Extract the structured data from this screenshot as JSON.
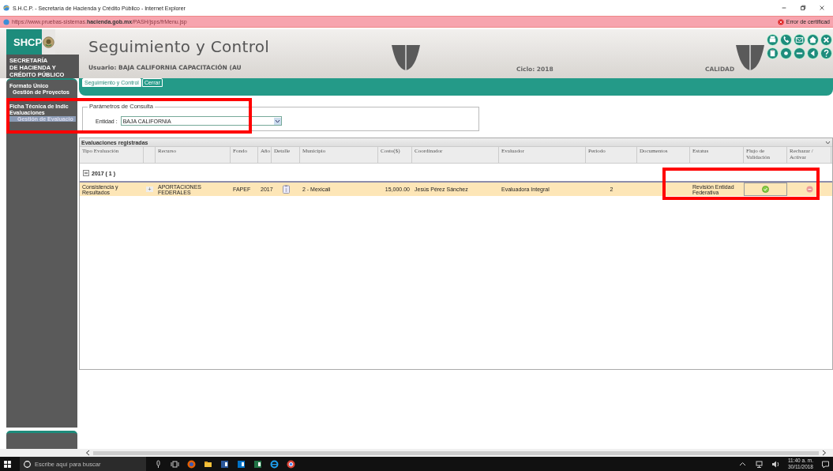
{
  "browser": {
    "title": "S.H.C.P. - Secretaría de Hacienda y Crédito Público - Internet Explorer",
    "url": {
      "prefix": "https://www.pruebas-sistemas.",
      "domain": "hacienda.gob.mx",
      "path": "/PASH/jsps/frMenu.jsp"
    },
    "cert_error": "Error de certificad"
  },
  "header": {
    "logo": "SHCP",
    "agency": [
      "SECRETARÍA",
      "DE HACIENDA Y",
      "CRÉDITO PÚBLICO"
    ],
    "app_title": "Seguimiento y Control",
    "user": "Usuario: BAJA CALIFORNIA CAPACITACIÓN (AU",
    "cycle": "Ciclo: 2018",
    "environment": "CALIDAD"
  },
  "tabs": [
    {
      "label": "Seguimiento y Control",
      "selected": true
    },
    {
      "label": "Cerrar",
      "selected": false
    }
  ],
  "sidebar": {
    "items": [
      {
        "label": "Formato Único",
        "selected": false,
        "children": [
          {
            "label": "Gestión de Proyectos",
            "selected": false
          }
        ]
      },
      {
        "label": "Ficha Técnica de Indic",
        "selected": false
      },
      {
        "label": "Evaluaciones",
        "selected": false,
        "children": [
          {
            "label": "Gestión de Evaluacio",
            "selected": true
          }
        ]
      }
    ]
  },
  "params": {
    "legend": "Parámetros de Consulta",
    "label": "Entidad :",
    "value": "BAJA CALIFORNIA"
  },
  "grid": {
    "title": "Evaluaciones registradas",
    "columns": [
      {
        "label": "Tipo Evaluación"
      },
      {
        "kind": "blank"
      },
      {
        "label": "Recurso"
      },
      {
        "label": "Fondo"
      },
      {
        "label": "Año"
      },
      {
        "label": "Detalle"
      },
      {
        "label": "Municipio"
      },
      {
        "label": "Costo($)"
      },
      {
        "label": "Coordinador"
      },
      {
        "label": "Evaluador"
      },
      {
        "label": "Periodo"
      },
      {
        "label": "Documentos"
      },
      {
        "label": "Estatus"
      },
      {
        "label": "Flujo de Validación"
      },
      {
        "label": "Rechazar / Activar"
      }
    ],
    "group": {
      "label": "2017 ( 1 )",
      "expanded": true
    },
    "rows": [
      {
        "selected": true,
        "cells": [
          {
            "kind": "text",
            "text": "Consistencia y Resultados"
          },
          {
            "kind": "expander",
            "text": "+"
          },
          {
            "kind": "text",
            "text": "APORTACIONES FEDERALES"
          },
          {
            "kind": "text",
            "text": "FAPEF"
          },
          {
            "kind": "text",
            "text": "2017"
          },
          {
            "kind": "detail"
          },
          {
            "kind": "text",
            "text": "2 - Mexicali"
          },
          {
            "kind": "number",
            "text": "15,000.00"
          },
          {
            "kind": "text",
            "text": "Jesús Pérez Sánchez"
          },
          {
            "kind": "text",
            "text": "Evaluadora Integral"
          },
          {
            "kind": "center",
            "text": "2"
          },
          {
            "kind": "empty"
          },
          {
            "kind": "text",
            "text": "Revisión Entidad Federativa"
          },
          {
            "kind": "approve"
          },
          {
            "kind": "reject"
          }
        ]
      }
    ]
  },
  "taskbar": {
    "search": {
      "placeholder": "Escribe aquí para buscar"
    },
    "time": "11:40 a. m.",
    "date": "30/11/2018"
  }
}
